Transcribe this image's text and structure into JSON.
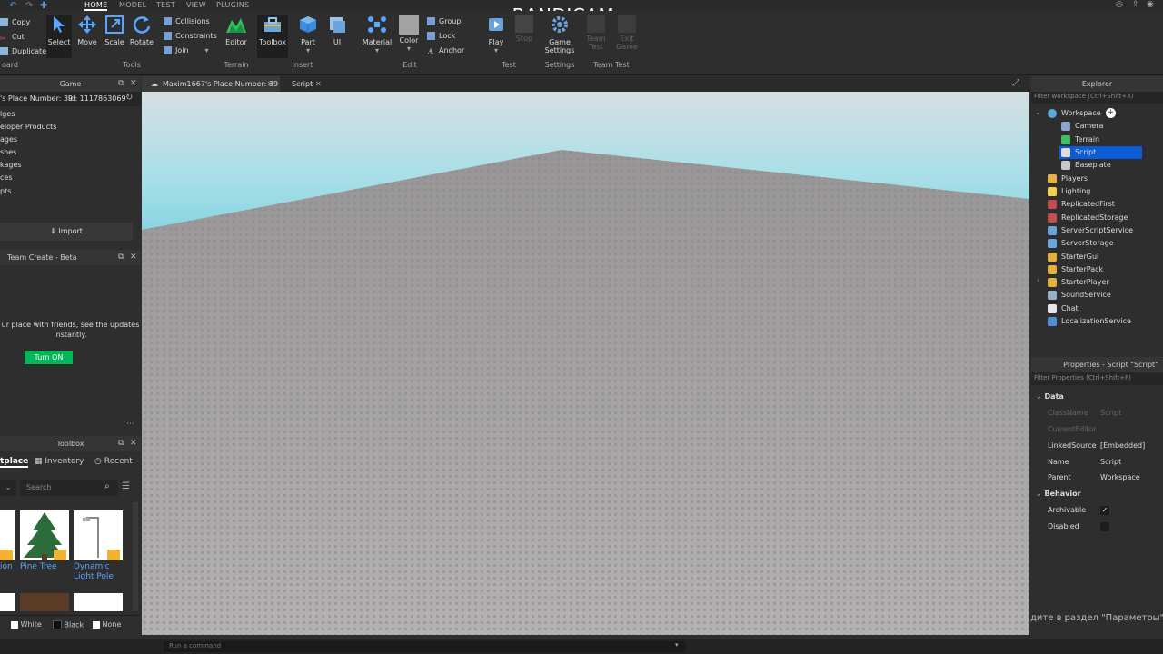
{
  "menu": {
    "tabs": [
      "HOME",
      "MODEL",
      "TEST",
      "VIEW",
      "PLUGINS"
    ],
    "active": "HOME"
  },
  "watermark": "www.BANDICAM.com",
  "clipboard": {
    "copy": "Copy",
    "cut": "Cut",
    "duplicate": "Duplicate",
    "group_label": "oard"
  },
  "tools": {
    "select": "Select",
    "move": "Move",
    "scale": "Scale",
    "rotate": "Rotate",
    "collisions": "Collisions",
    "constraints": "Constraints",
    "join": "Join",
    "group_label": "Tools"
  },
  "terrain": {
    "editor": "Editor",
    "group_label": "Terrain"
  },
  "insert": {
    "toolbox": "Toolbox",
    "part": "Part",
    "ui": "UI",
    "group_label": "Insert"
  },
  "edit": {
    "material": "Material",
    "color": "Color",
    "group": "Group",
    "lock": "Lock",
    "anchor": "Anchor",
    "group_label": "Edit"
  },
  "test": {
    "play": "Play",
    "stop": "Stop",
    "group_label": "Test"
  },
  "settings": {
    "game_settings_1": "Game",
    "game_settings_2": "Settings",
    "group_label": "Settings"
  },
  "teamtest": {
    "team_test_1": "Team",
    "team_test_2": "Test",
    "exit_game_1": "Exit",
    "exit_game_2": "Game",
    "group_label": "Team Test"
  },
  "game_panel": {
    "title": "Game",
    "place_name": "'s Place Number: 39",
    "place_id": "Id: 1117863069",
    "items": [
      "lges",
      "eloper Products",
      "ages",
      "shes",
      "kages",
      "ces",
      "pts"
    ],
    "import": "Import"
  },
  "team_create": {
    "title": "Team Create - Beta",
    "text_1": "ur place with friends, see the updates",
    "text_2": "instantly.",
    "button": "Turn ON"
  },
  "toolbox": {
    "title": "Toolbox",
    "tabs": [
      "tplace",
      "Inventory",
      "Recent"
    ],
    "search_placeholder": "Search",
    "items": [
      "ion",
      "Pine Tree",
      "Dynamic Light Pole"
    ],
    "bg_options": [
      "White",
      "Black",
      "None"
    ]
  },
  "doc_tabs": [
    "Maxim1667's Place Number: 39",
    "Script"
  ],
  "explorer": {
    "title": "Explorer",
    "filter_placeholder": "Filter workspace (Ctrl+Shift+X)",
    "items": [
      {
        "label": "Workspace",
        "icon_color": "#5aa9d6"
      },
      {
        "label": "Camera",
        "icon_color": "#8aa6c8"
      },
      {
        "label": "Terrain",
        "icon_color": "#3fbf5f"
      },
      {
        "label": "Script",
        "icon_color": "#dddddd"
      },
      {
        "label": "Baseplate",
        "icon_color": "#c9c9c9"
      },
      {
        "label": "Players",
        "icon_color": "#e4b24a"
      },
      {
        "label": "Lighting",
        "icon_color": "#f2d04e"
      },
      {
        "label": "ReplicatedFirst",
        "icon_color": "#c24f4f"
      },
      {
        "label": "ReplicatedStorage",
        "icon_color": "#c24f4f"
      },
      {
        "label": "ServerScriptService",
        "icon_color": "#6aa4d8"
      },
      {
        "label": "ServerStorage",
        "icon_color": "#6aa4d8"
      },
      {
        "label": "StarterGui",
        "icon_color": "#e0b040"
      },
      {
        "label": "StarterPack",
        "icon_color": "#e0b040"
      },
      {
        "label": "StarterPlayer",
        "icon_color": "#e0b040"
      },
      {
        "label": "SoundService",
        "icon_color": "#9ab0c6"
      },
      {
        "label": "Chat",
        "icon_color": "#e6e6e6"
      },
      {
        "label": "LocalizationService",
        "icon_color": "#4e8fd6"
      }
    ]
  },
  "properties": {
    "title": "Properties - Script \"Script\"",
    "filter_placeholder": "Filter Properties (Ctrl+Shift+P)",
    "section_data": "Data",
    "classname_key": "ClassName",
    "classname_val": "Script",
    "current_editor_key": "CurrentEditor",
    "linked_source_key": "LinkedSource",
    "linked_source_val": "[Embedded]",
    "name_key": "Name",
    "name_val": "Script",
    "parent_key": "Parent",
    "parent_val": "Workspace",
    "section_behavior": "Behavior",
    "archivable_key": "Archivable",
    "disabled_key": "Disabled"
  },
  "activation_text": "дите в раздел \"Параметры\".",
  "command_bar": {
    "placeholder": "Run a command"
  },
  "colors": {
    "accent_green": "#02b757",
    "selection": "#0b5cd6",
    "sky": "#a9dfe8"
  }
}
